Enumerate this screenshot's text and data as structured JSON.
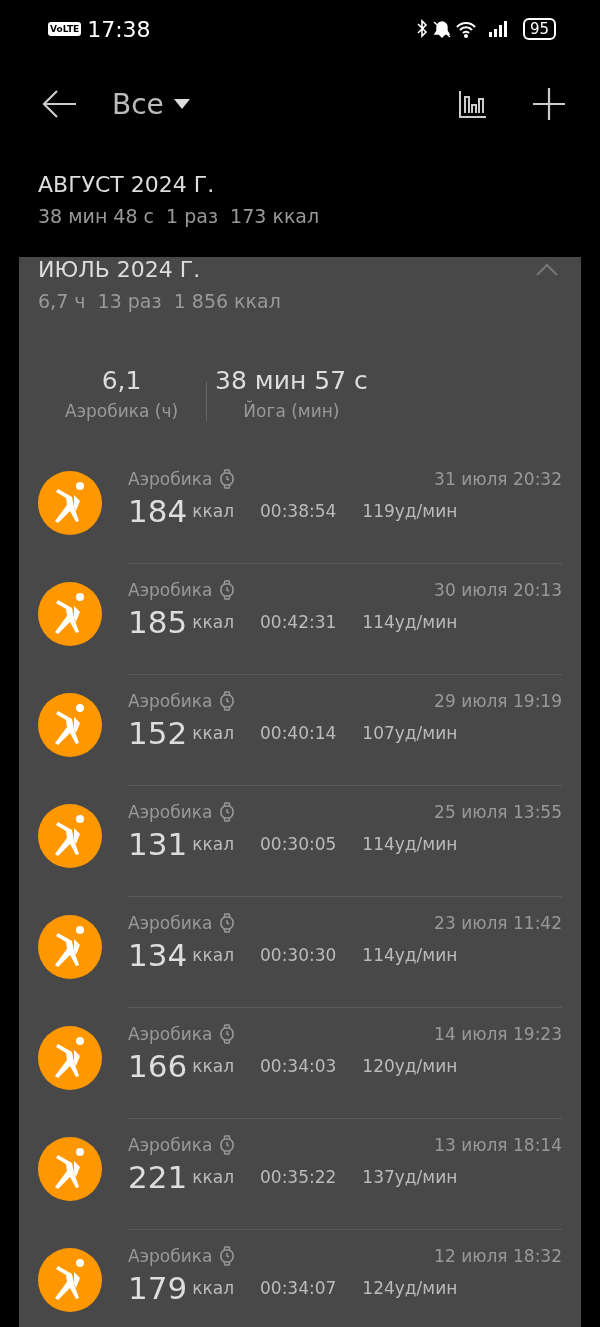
{
  "status_bar": {
    "network_badge": "VoLTE",
    "time": "17:38",
    "battery": "95"
  },
  "header": {
    "filter": "Все"
  },
  "months": [
    {
      "title": "АВГУСТ 2024 Г.",
      "summary": "38 мин 48 с  1 раз  173 ккал",
      "expanded": false
    },
    {
      "title": "ИЮЛЬ 2024 Г.",
      "summary": "6,7 ч  13 раз  1 856 ккал",
      "expanded": true,
      "totals": [
        {
          "value": "6,1",
          "label": "Аэробика (ч)"
        },
        {
          "value": "38 мин 57 с",
          "label": "Йога (мин)"
        }
      ],
      "workouts": [
        {
          "type": "Аэробика",
          "date": "31 июля 20:32",
          "kcal": "184",
          "unit": "ккал",
          "duration": "00:38:54",
          "heart_rate": "119уд/мин"
        },
        {
          "type": "Аэробика",
          "date": "30 июля 20:13",
          "kcal": "185",
          "unit": "ккал",
          "duration": "00:42:31",
          "heart_rate": "114уд/мин"
        },
        {
          "type": "Аэробика",
          "date": "29 июля 19:19",
          "kcal": "152",
          "unit": "ккал",
          "duration": "00:40:14",
          "heart_rate": "107уд/мин"
        },
        {
          "type": "Аэробика",
          "date": "25 июля 13:55",
          "kcal": "131",
          "unit": "ккал",
          "duration": "00:30:05",
          "heart_rate": "114уд/мин"
        },
        {
          "type": "Аэробика",
          "date": "23 июля 11:42",
          "kcal": "134",
          "unit": "ккал",
          "duration": "00:30:30",
          "heart_rate": "114уд/мин"
        },
        {
          "type": "Аэробика",
          "date": "14 июля 19:23",
          "kcal": "166",
          "unit": "ккал",
          "duration": "00:34:03",
          "heart_rate": "120уд/мин"
        },
        {
          "type": "Аэробика",
          "date": "13 июля 18:14",
          "kcal": "221",
          "unit": "ккал",
          "duration": "00:35:22",
          "heart_rate": "137уд/мин"
        },
        {
          "type": "Аэробика",
          "date": "12 июля 18:32",
          "kcal": "179",
          "unit": "ккал",
          "duration": "00:34:07",
          "heart_rate": "124уд/мин"
        }
      ]
    }
  ]
}
